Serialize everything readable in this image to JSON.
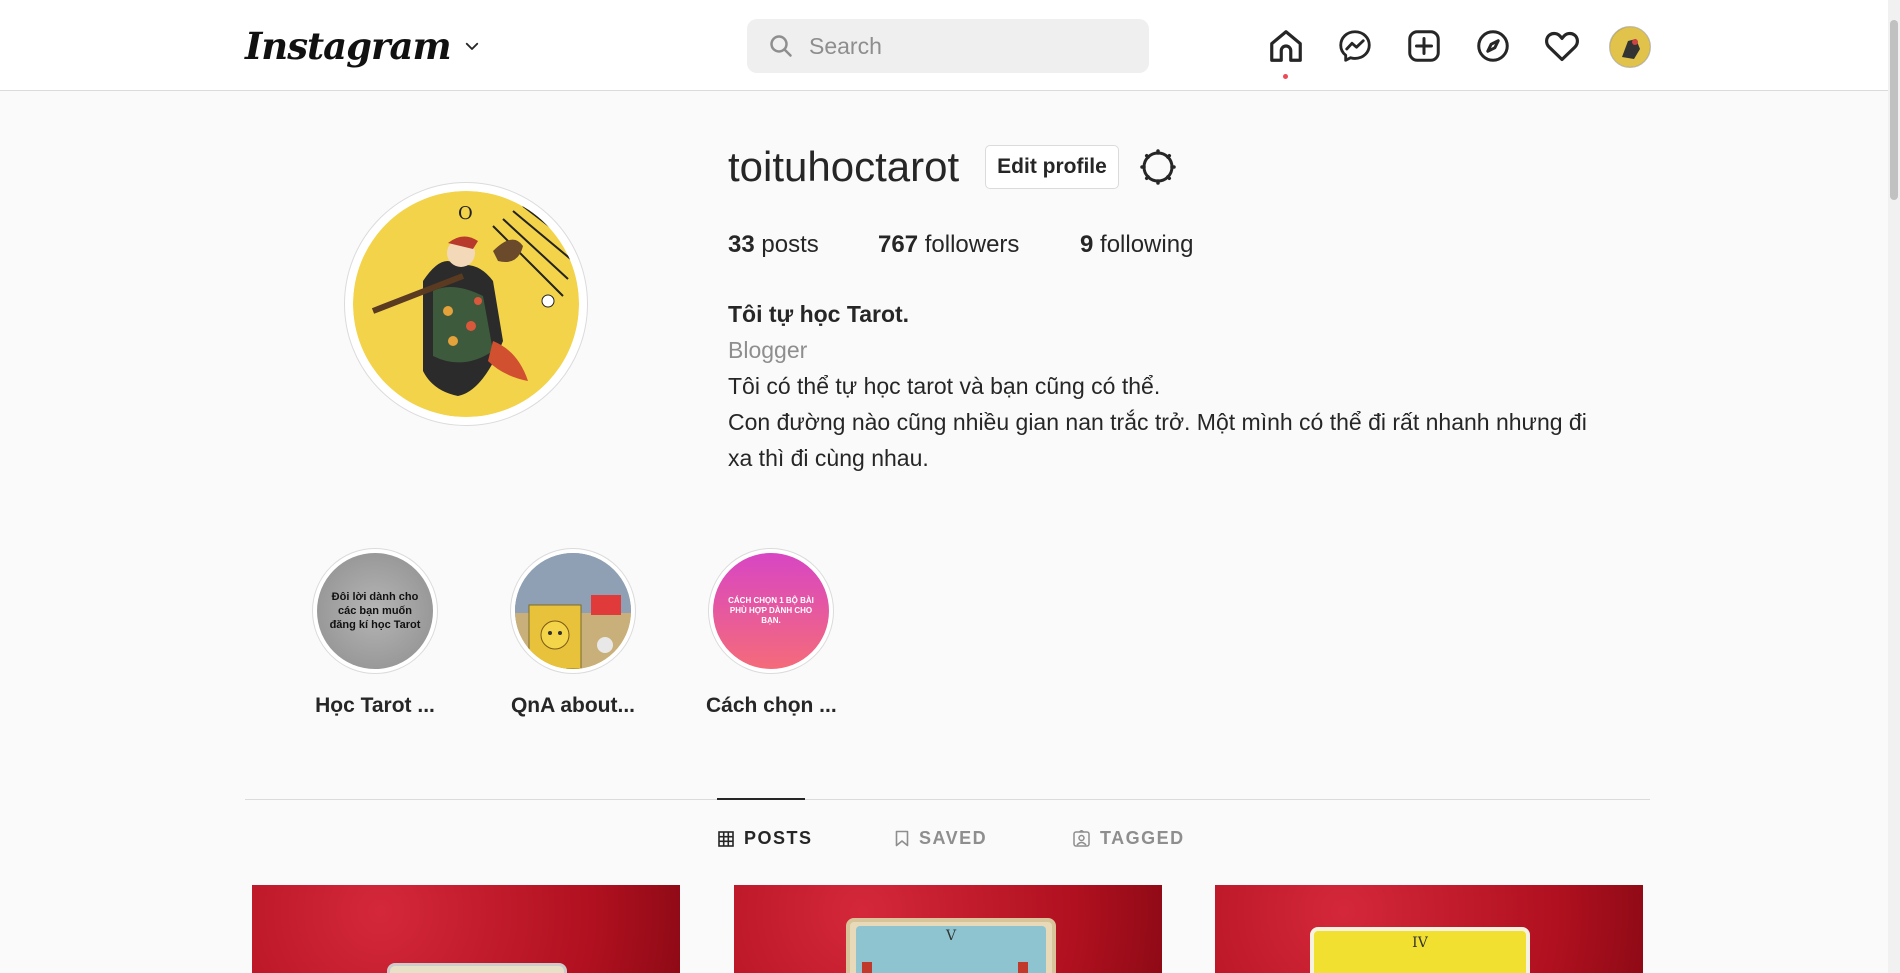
{
  "topbar": {
    "logo": "Instagram",
    "search_placeholder": "Search",
    "notification_color": "#ed4956",
    "icons": [
      "home-icon",
      "messenger-icon",
      "new-post-icon",
      "explore-icon",
      "activity-heart-icon",
      "profile-avatar"
    ]
  },
  "profile": {
    "username": "toituhoctarot",
    "edit_label": "Edit profile",
    "stats": {
      "posts_count": "33",
      "posts_label": "posts",
      "followers_count": "767",
      "followers_label": "followers",
      "following_count": "9",
      "following_label": "following"
    },
    "bio": {
      "name": "Tôi tự học Tarot.",
      "category": "Blogger",
      "line1": "Tôi có thể tự học tarot và bạn cũng có thể.",
      "line2": "Con đường nào cũng nhiều gian nan trắc trở. Một mình có thể đi rất nhanh nhưng đi",
      "line3": "xa thì đi cùng nhau."
    }
  },
  "highlights": [
    {
      "label": "Học Tarot ...",
      "cover_text": "Đôi lời dành cho các bạn muốn đăng kí học Tarot"
    },
    {
      "label": "QnA about..."
    },
    {
      "label": "Cách chọn ...",
      "cover_text": "CÁCH CHỌN 1 BỘ BÀI PHÙ HỢP DÀNH CHO BẠN."
    }
  ],
  "tabs": [
    {
      "label": "POSTS",
      "active": true
    },
    {
      "label": "SAVED",
      "active": false
    },
    {
      "label": "TAGGED",
      "active": false
    }
  ],
  "posts": [
    {
      "card_label": ""
    },
    {
      "card_label": "V"
    },
    {
      "card_label": "IV"
    }
  ]
}
